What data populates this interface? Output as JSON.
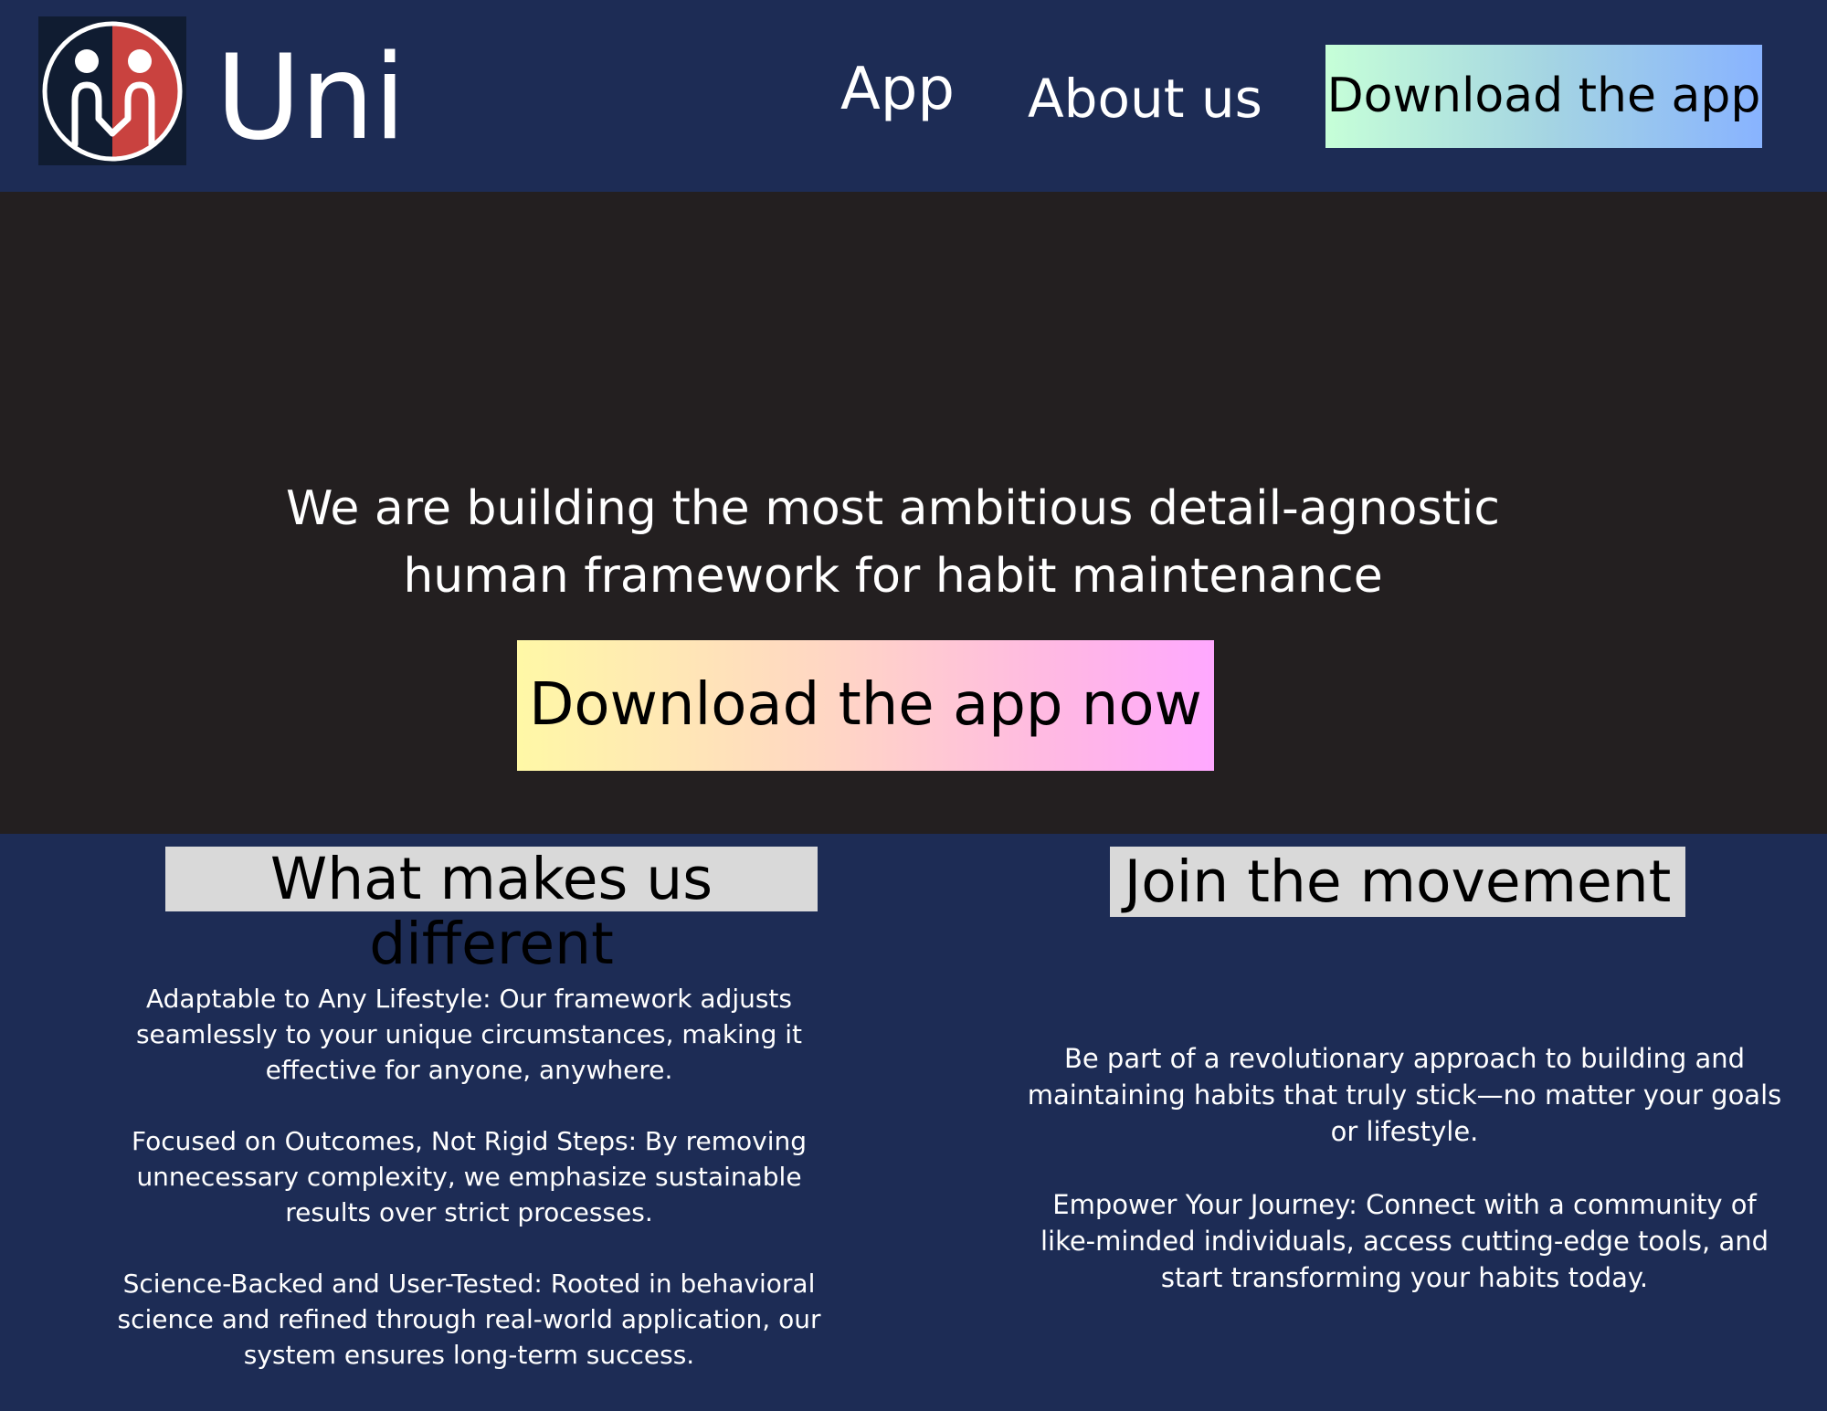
{
  "header": {
    "brand": "Uni",
    "logo_icon": "two-people-holding-hands-logo",
    "nav": {
      "app": "App",
      "about": "About us"
    },
    "download_button": "Download the app"
  },
  "hero": {
    "headline_line1": "We are building the most ambitious detail-agnostic",
    "headline_line2": "human framework for habit maintenance",
    "cta_button": "Download the app now"
  },
  "sections": {
    "different": {
      "heading": "What makes us different",
      "paragraphs": [
        "Adaptable to Any Lifestyle: Our framework adjusts seamlessly to your unique circumstances, making it effective for anyone, anywhere.",
        "Focused on Outcomes, Not Rigid Steps: By removing unnecessary complexity, we emphasize sustainable results over strict processes.",
        "Science-Backed and User-Tested: Rooted in behavioral science and refined through real-world application, our system ensures long-term success."
      ]
    },
    "movement": {
      "heading": "Join the movement",
      "paragraphs": [
        "Be part of a revolutionary approach to building and maintaining habits that truly stick—no matter your goals or lifestyle.",
        "Empower Your Journey: Connect with a community of like-minded individuals, access cutting-edge tools, and start transforming your habits today."
      ]
    }
  },
  "colors": {
    "navy": "#1d2c55",
    "hero_bg": "#231f20",
    "heading_bg": "#d9d9d9",
    "logo_red": "#c9423f"
  }
}
